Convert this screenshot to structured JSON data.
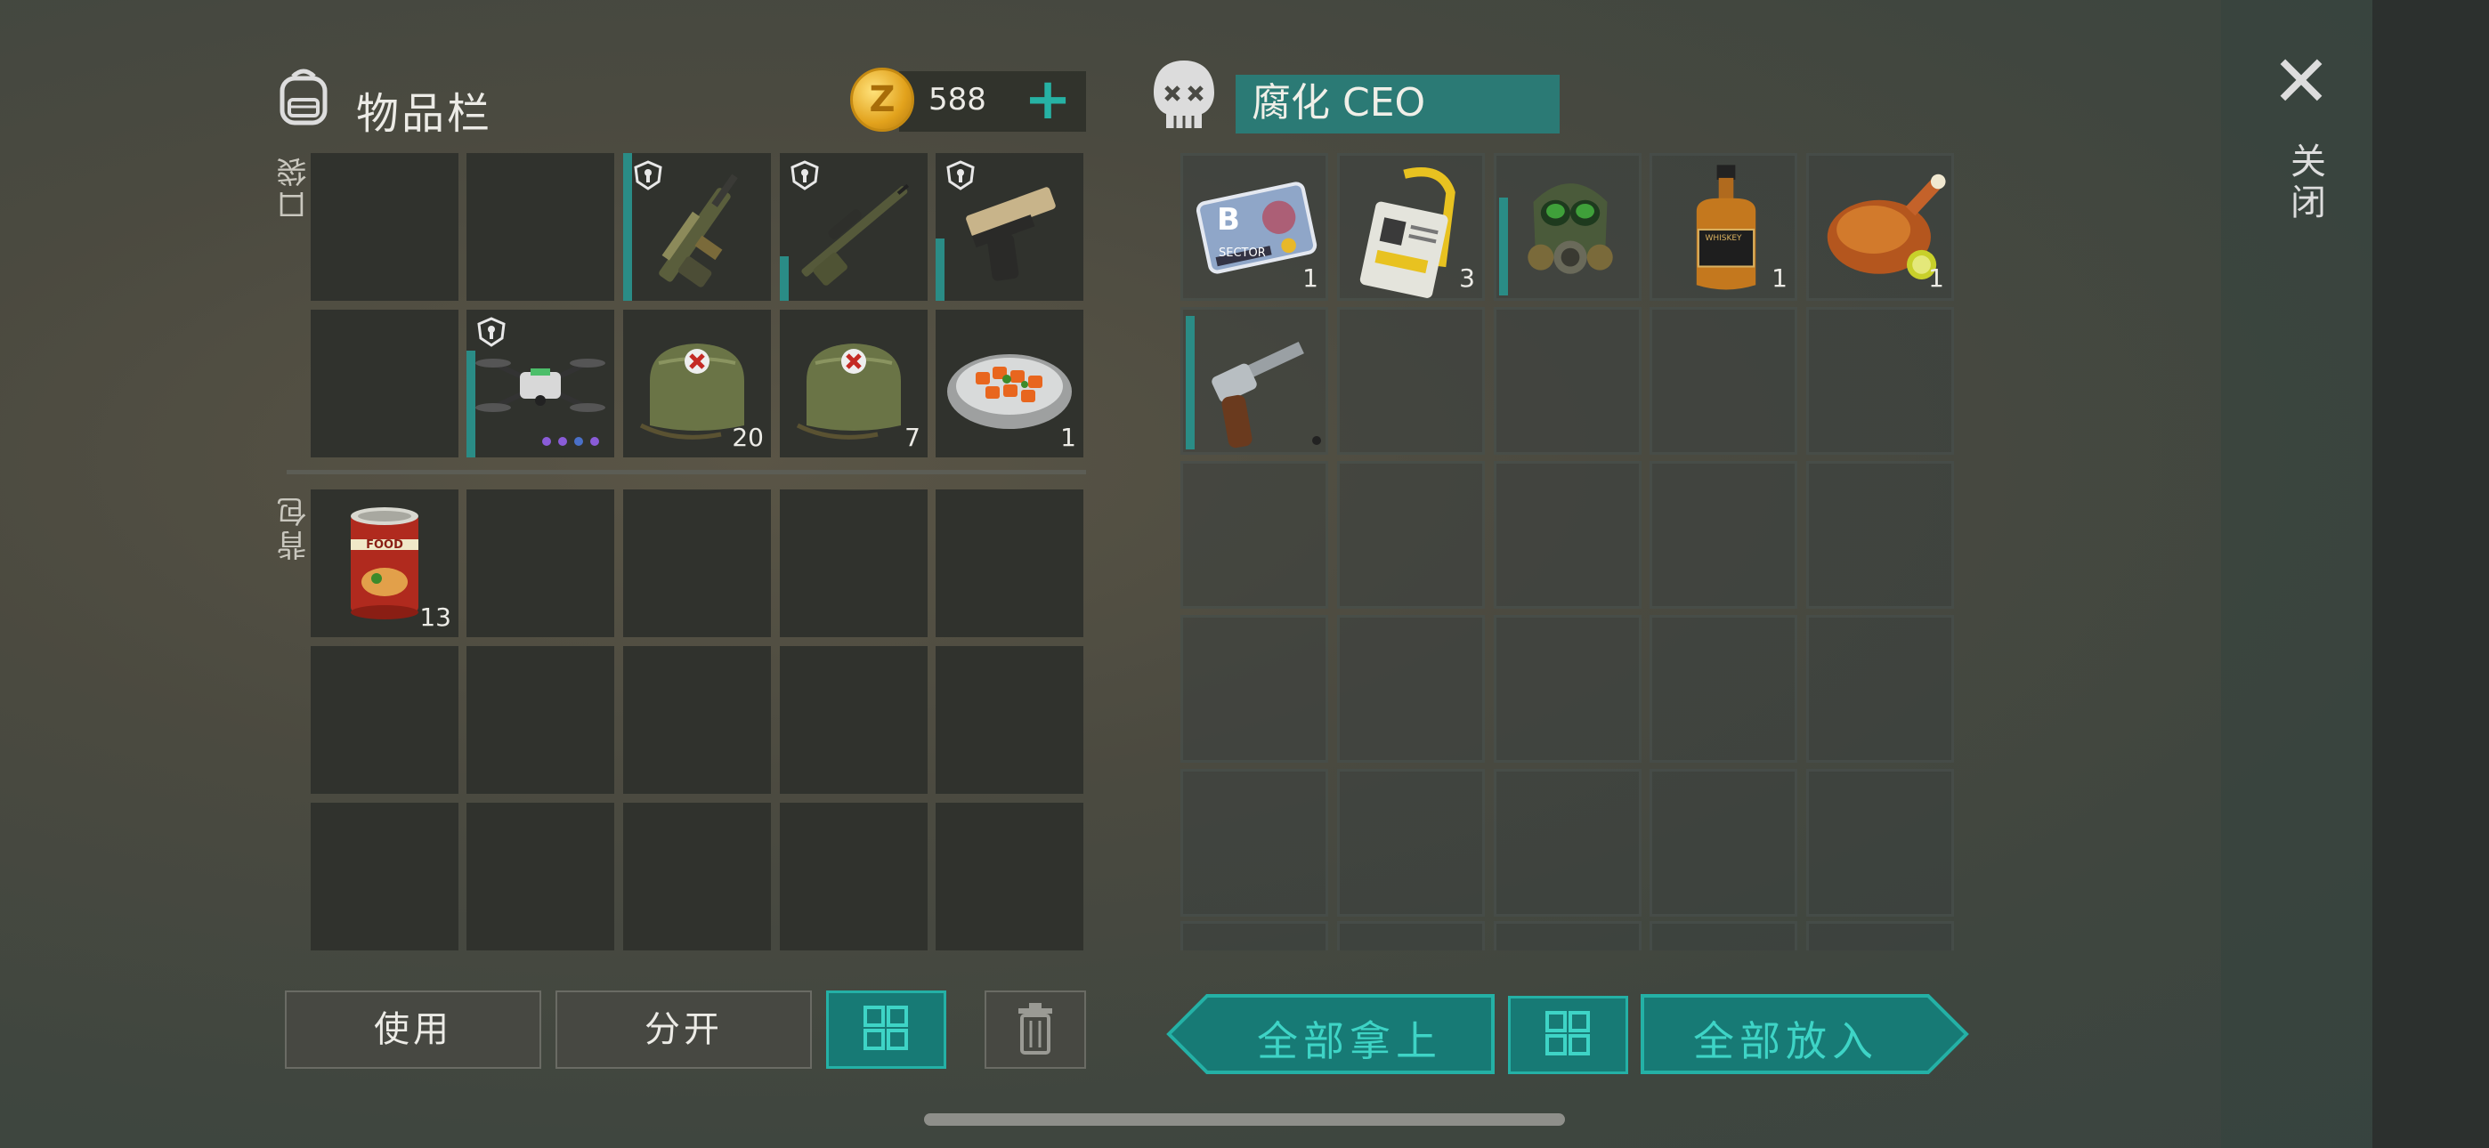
{
  "inventory": {
    "title": "物品栏",
    "coins": "588",
    "pocket_label": "口袋",
    "backpack_label": "背包",
    "slots": {
      "p1": {
        "qty": ""
      },
      "p2": {
        "qty": ""
      },
      "p3": {
        "qty": ""
      },
      "p4": {
        "qty": ""
      },
      "p5": {
        "qty": ""
      },
      "p6": {
        "qty": ""
      },
      "p7": {
        "qty": ""
      },
      "p8": {
        "qty": "20"
      },
      "p9": {
        "qty": "7"
      },
      "p10": {
        "qty": "1"
      },
      "b1": {
        "qty": "13",
        "label": "FOOD"
      }
    },
    "buttons": {
      "use": "使用",
      "split": "分开"
    }
  },
  "container": {
    "title": "腐化 CEO",
    "slots": {
      "c1": {
        "qty": "1",
        "letter": "B",
        "label": "SECTOR"
      },
      "c2": {
        "qty": "3"
      },
      "c3": {
        "qty": ""
      },
      "c4": {
        "qty": "1",
        "label": "WHISKEY"
      },
      "c5": {
        "qty": "1"
      },
      "c6": {
        "qty": ""
      }
    },
    "buttons": {
      "take_all": "全部拿上",
      "put_all": "全部放入"
    }
  },
  "close_label": "关闭",
  "colors": {
    "accent": "#24b1a6",
    "teal_fill": "#177a75",
    "slot": "#30322d",
    "gold": "#e2a21c"
  },
  "icons": [
    "backpack-icon",
    "coin-icon",
    "plus-icon",
    "skull-icon",
    "close-icon",
    "sort-grid-icon",
    "trash-icon"
  ]
}
